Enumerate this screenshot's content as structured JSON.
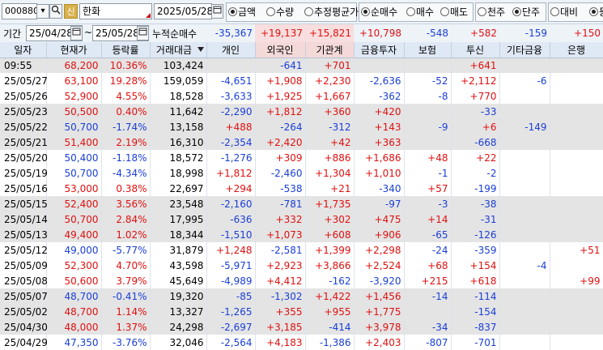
{
  "toolbar": {
    "code": "000880",
    "badge": "신",
    "name": "한화",
    "date": "2025/05/28",
    "group1": [
      {
        "label": "금액",
        "on": true
      },
      {
        "label": "수량",
        "on": false
      },
      {
        "label": "추정평균가",
        "on": false
      }
    ],
    "group2": [
      {
        "label": "순매수",
        "on": true
      },
      {
        "label": "매수",
        "on": false
      },
      {
        "label": "매도",
        "on": false
      }
    ],
    "group3": [
      {
        "label": "천주",
        "on": false
      },
      {
        "label": "단주",
        "on": true
      }
    ],
    "group4": [
      {
        "label": "대비",
        "on": false
      },
      {
        "label": "등",
        "on": true
      }
    ]
  },
  "period": {
    "label": "기간",
    "from": "25/04/28",
    "to": "25/05/28",
    "sep": "~",
    "sum_label": "누적순매수"
  },
  "sums": [
    "-35,367",
    "+19,137",
    "+15,821",
    "+10,798",
    "-548",
    "+582",
    "-159",
    "+150"
  ],
  "headers": [
    "일자",
    "현재가",
    "등락률",
    "거래대금",
    "개인",
    "외국인",
    "기관계",
    "금융투자",
    "보험",
    "투신",
    "기타금융",
    "은행"
  ],
  "rows": [
    {
      "c": [
        "09:55",
        "68,200",
        "10.36%",
        "103,424",
        "",
        "-641",
        "+701",
        "",
        "",
        "+641",
        "",
        ""
      ],
      "g": 1
    },
    {
      "c": [
        "25/05/27",
        "63,100",
        "19.28%",
        "159,059",
        "-4,651",
        "+1,908",
        "+2,230",
        "-2,636",
        "-52",
        "+2,112",
        "-6",
        ""
      ],
      "g": 0
    },
    {
      "c": [
        "25/05/26",
        "52,900",
        "4.55%",
        "18,528",
        "-3,633",
        "+1,925",
        "+1,667",
        "-362",
        "-8",
        "+770",
        "",
        ""
      ],
      "g": 0
    },
    {
      "c": [
        "25/05/23",
        "50,500",
        "0.40%",
        "11,642",
        "-2,290",
        "+1,812",
        "+360",
        "+420",
        "",
        "-33",
        "",
        ""
      ],
      "g": 1
    },
    {
      "c": [
        "25/05/22",
        "50,700",
        "-1.74%",
        "13,158",
        "+488",
        "-264",
        "-312",
        "+143",
        "-9",
        "+6",
        "-149",
        ""
      ],
      "g": 1
    },
    {
      "c": [
        "25/05/21",
        "51,400",
        "2.19%",
        "16,310",
        "-2,354",
        "+2,420",
        "+42",
        "+363",
        "",
        "-668",
        "",
        ""
      ],
      "g": 1
    },
    {
      "c": [
        "25/05/20",
        "50,400",
        "-1.18%",
        "18,572",
        "-1,276",
        "+309",
        "+886",
        "+1,686",
        "+48",
        "+22",
        "",
        ""
      ],
      "g": 0
    },
    {
      "c": [
        "25/05/19",
        "50,700",
        "-4.34%",
        "18,998",
        "+1,812",
        "-2,460",
        "+1,304",
        "+1,010",
        "-1",
        "-2",
        "",
        ""
      ],
      "g": 0
    },
    {
      "c": [
        "25/05/16",
        "53,000",
        "0.38%",
        "22,697",
        "+294",
        "-538",
        "+21",
        "-340",
        "+57",
        "-199",
        "",
        ""
      ],
      "g": 0
    },
    {
      "c": [
        "25/05/15",
        "52,400",
        "3.56%",
        "23,548",
        "-2,160",
        "-781",
        "+1,735",
        "-97",
        "-3",
        "-38",
        "",
        ""
      ],
      "g": 1
    },
    {
      "c": [
        "25/05/14",
        "50,700",
        "2.84%",
        "17,995",
        "-636",
        "+332",
        "+302",
        "+475",
        "+14",
        "-31",
        "",
        ""
      ],
      "g": 1
    },
    {
      "c": [
        "25/05/13",
        "49,400",
        "1.02%",
        "18,344",
        "-1,510",
        "+1,073",
        "+608",
        "+906",
        "-65",
        "-126",
        "",
        ""
      ],
      "g": 1
    },
    {
      "c": [
        "25/05/12",
        "49,000",
        "-5.77%",
        "31,879",
        "+1,248",
        "-2,581",
        "+1,399",
        "+2,298",
        "-24",
        "-359",
        "",
        "+51"
      ],
      "g": 0
    },
    {
      "c": [
        "25/05/09",
        "52,300",
        "4.70%",
        "43,598",
        "-5,971",
        "+2,923",
        "+3,866",
        "+2,524",
        "+68",
        "+154",
        "-4",
        ""
      ],
      "g": 0
    },
    {
      "c": [
        "25/05/08",
        "50,600",
        "3.79%",
        "45,649",
        "-4,989",
        "+4,412",
        "-162",
        "-3,920",
        "+215",
        "+618",
        "",
        "+99"
      ],
      "g": 0
    },
    {
      "c": [
        "25/05/07",
        "48,700",
        "-0.41%",
        "19,320",
        "-85",
        "-1,302",
        "+1,422",
        "+1,456",
        "-14",
        "-114",
        "",
        ""
      ],
      "g": 1
    },
    {
      "c": [
        "25/05/02",
        "48,700",
        "1.14%",
        "13,327",
        "-1,265",
        "+355",
        "+955",
        "+1,775",
        "",
        "-154",
        "",
        ""
      ],
      "g": 1
    },
    {
      "c": [
        "25/04/30",
        "48,000",
        "1.37%",
        "24,298",
        "-2,697",
        "+3,185",
        "-414",
        "+3,978",
        "-34",
        "-837",
        "",
        ""
      ],
      "g": 1
    },
    {
      "c": [
        "25/04/29",
        "47,350",
        "-3.76%",
        "32,046",
        "-2,564",
        "+4,183",
        "-1,386",
        "+2,403",
        "-807",
        "-701",
        "",
        ""
      ],
      "g": 0
    }
  ]
}
